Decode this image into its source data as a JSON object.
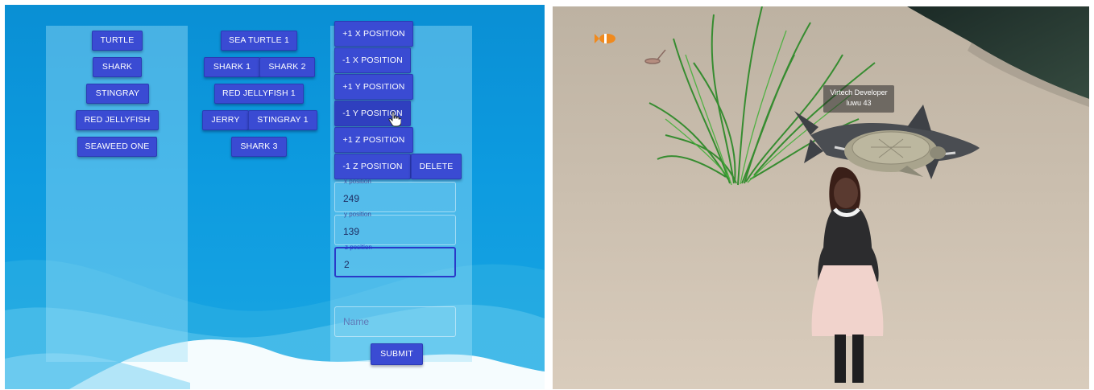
{
  "app": {
    "entity_buttons": [
      "TURTLE",
      "SHARK",
      "STINGRAY",
      "RED JELLYFISH",
      "SEAWEED ONE"
    ],
    "instance_buttons": [
      "SEA TURTLE 1",
      "SHARK 1",
      "SHARK 2",
      "RED JELLYFISH 1",
      "JERRY",
      "STINGRAY 1",
      "SHARK 3"
    ],
    "controls": {
      "x_plus": "+1 X POSITION",
      "x_minus": "-1 X POSITION",
      "y_plus": "+1 Y POSITION",
      "y_minus": "-1 Y POSITION",
      "z_plus": "+1 Z POSITION",
      "z_minus": "-1 Z POSITION",
      "delete": "DELETE"
    },
    "fields": {
      "x_label": "x position",
      "x_value": "249",
      "y_label": "y position",
      "y_value": "139",
      "z_label": "z position",
      "z_value": "2",
      "name_placeholder": "Name"
    },
    "submit": "SUBMIT"
  },
  "scene": {
    "nametag_line1": "Virtech Developer",
    "nametag_line2": "luwu 43"
  }
}
